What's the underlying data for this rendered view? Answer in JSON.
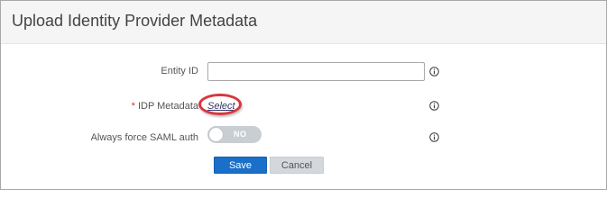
{
  "dialog": {
    "title": "Upload Identity Provider Metadata"
  },
  "form": {
    "entity_id": {
      "label": "Entity ID",
      "value": "",
      "placeholder": ""
    },
    "idp_metadata": {
      "required_marker": "*",
      "label": "IDP Metadata",
      "link_label": "Select"
    },
    "force_saml": {
      "label": "Always force SAML auth",
      "toggle_text": "NO",
      "enabled": false
    },
    "info_icon": "info-circle-icon"
  },
  "buttons": {
    "save_label": "Save",
    "cancel_label": "Cancel"
  },
  "colors": {
    "primary_button": "#1a6fc9",
    "secondary_button": "#d4d8dc",
    "required_asterisk": "#d9302c",
    "annotation_ring": "#d9363e",
    "toggle_off": "#c9ced3"
  }
}
